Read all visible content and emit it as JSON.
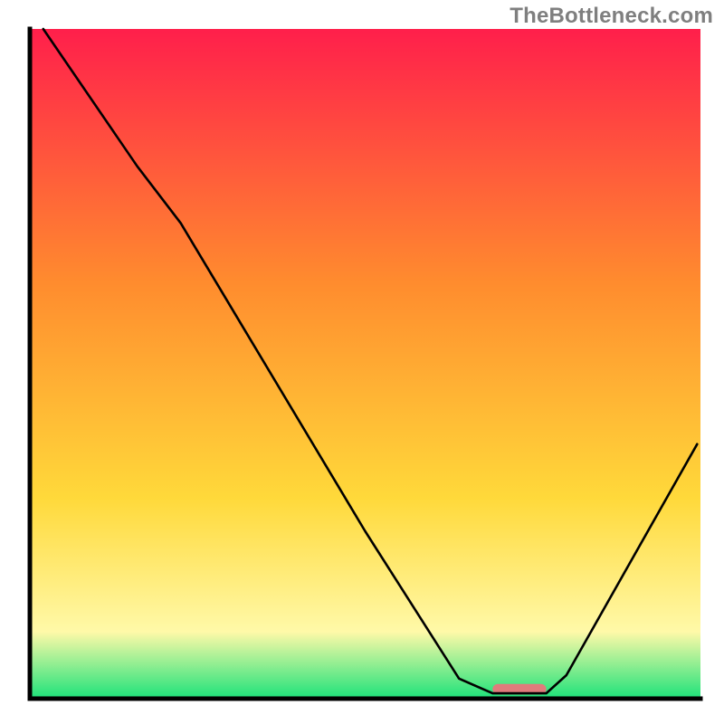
{
  "watermark": "TheBottleneck.com",
  "chart_data": {
    "type": "line",
    "title": "",
    "xlabel": "",
    "ylabel": "",
    "xlim": [
      0,
      100
    ],
    "ylim": [
      0,
      100
    ],
    "background_gradient": {
      "top_color": "#ff1f4b",
      "mid_color1": "#ff8c2e",
      "mid_color2": "#ffd93a",
      "low_color": "#fff9a8",
      "bottom_color": "#1de27a"
    },
    "series": [
      {
        "name": "bottleneck-curve",
        "stroke": "#000000",
        "stroke_width": 2.6,
        "points": [
          {
            "x": 2.0,
            "y": 100.0
          },
          {
            "x": 16.0,
            "y": 79.5
          },
          {
            "x": 22.5,
            "y": 71.0
          },
          {
            "x": 50.0,
            "y": 25.0
          },
          {
            "x": 64.0,
            "y": 3.0
          },
          {
            "x": 69.0,
            "y": 0.8
          },
          {
            "x": 77.0,
            "y": 0.8
          },
          {
            "x": 80.0,
            "y": 3.5
          },
          {
            "x": 99.5,
            "y": 38.0
          }
        ]
      }
    ],
    "highlight_segment": {
      "name": "optimal-highlight",
      "fill": "#e07c7c",
      "x_start": 69.0,
      "x_end": 77.0,
      "y": 0.6,
      "height": 1.6
    },
    "axis": {
      "stroke": "#000000",
      "stroke_width": 5
    }
  }
}
